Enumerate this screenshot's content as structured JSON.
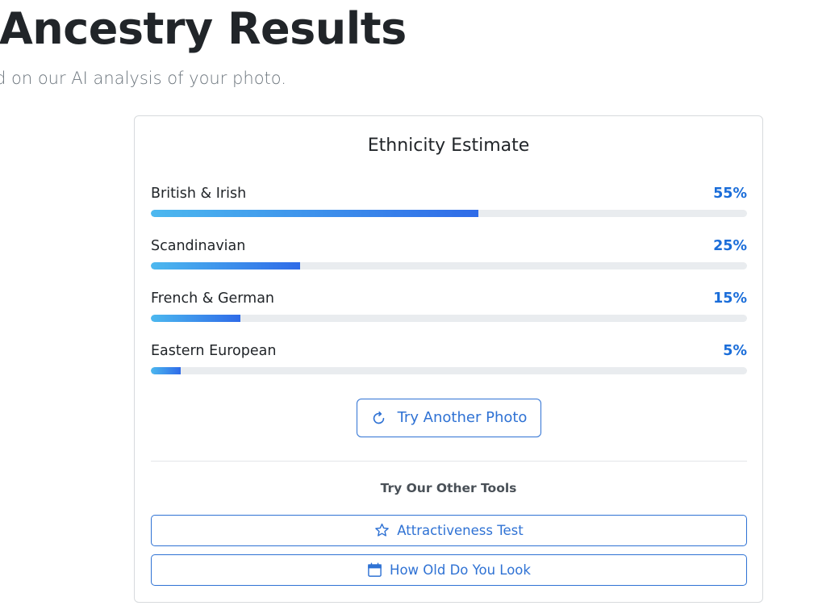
{
  "header": {
    "title": "Ancestry Results",
    "subtitle": "d on our AI analysis of your photo."
  },
  "card": {
    "title": "Ethnicity Estimate",
    "ethnicities": [
      {
        "name": "British & Irish",
        "percent_label": "55%",
        "value": 55
      },
      {
        "name": "Scandinavian",
        "percent_label": "25%",
        "value": 25
      },
      {
        "name": "French & German",
        "percent_label": "15%",
        "value": 15
      },
      {
        "name": "Eastern European",
        "percent_label": "5%",
        "value": 5
      }
    ],
    "retry_button": {
      "label": "Try Another Photo",
      "icon": "refresh-icon"
    },
    "other_tools": {
      "title": "Try Our Other Tools",
      "items": [
        {
          "label": "Attractiveness Test",
          "icon": "star-icon"
        },
        {
          "label": "How Old Do You Look",
          "icon": "calendar-icon"
        }
      ]
    }
  },
  "colors": {
    "accent": "#2f72d4",
    "percent": "#1a6dd9",
    "bar_gradient_start": "#4cb8ef",
    "bar_gradient_end": "#2f6be8",
    "track": "#e9ecef"
  }
}
